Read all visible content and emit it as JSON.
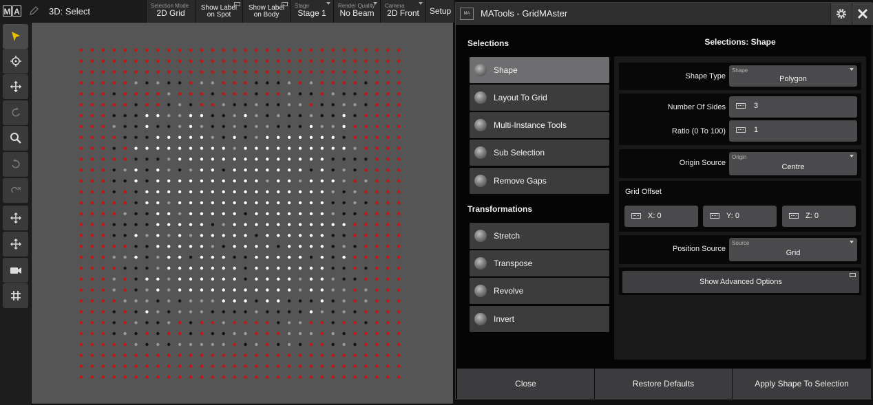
{
  "topbar": {
    "logo": [
      "M",
      "A"
    ],
    "view_title": "3D: Select",
    "buttons": [
      {
        "caption": "Selection Mode",
        "value": "2D Grid"
      },
      {
        "caption": "",
        "value": "Show Label on Spot",
        "line1": "Show Label",
        "line2": "on Spot"
      },
      {
        "caption": "",
        "value": "Show Label on Body",
        "line1": "Show Label",
        "line2": "on Body"
      },
      {
        "caption": "Stage",
        "value": "Stage 1"
      },
      {
        "caption": "Render Quality",
        "value": "No Beam"
      },
      {
        "caption": "Camera",
        "value": "2D Front"
      },
      {
        "caption": "",
        "value": "Setup"
      }
    ]
  },
  "toolbar": {
    "tools": [
      "select-arrow-icon",
      "crosshair-icon",
      "move-icon",
      "rotate-icon",
      "zoom-icon",
      "undo-rotate-icon",
      "pan-rotate-icon",
      "move-alt-icon",
      "move-alt2-icon",
      "camera-icon",
      "grid-icon"
    ]
  },
  "viewport": {
    "colors": {
      "background": "#555555",
      "red": "#cc1111",
      "white": "#ffffff",
      "grey": "#9a9a9a",
      "black": "#111111"
    }
  },
  "plugin": {
    "title": "MATools - GridMAster",
    "icon_text": "MA",
    "selections_heading": "Selections",
    "selections": [
      {
        "label": "Shape",
        "active": true
      },
      {
        "label": "Layout To Grid",
        "active": false
      },
      {
        "label": "Multi-Instance Tools",
        "active": false
      },
      {
        "label": "Sub Selection",
        "active": false
      },
      {
        "label": "Remove Gaps",
        "active": false
      }
    ],
    "transformations_heading": "Transformations",
    "transformations": [
      {
        "label": "Stretch"
      },
      {
        "label": "Transpose"
      },
      {
        "label": "Revolve"
      },
      {
        "label": "Invert"
      }
    ],
    "panel_title": "Selections: Shape",
    "shape_type": {
      "label": "Shape Type",
      "caption": "Shape",
      "value": "Polygon"
    },
    "number_of_sides": {
      "label": "Number Of Sides",
      "value": "3"
    },
    "ratio": {
      "label": "Ratio (0 To 100)",
      "value": "1"
    },
    "origin_source": {
      "label": "Origin Source",
      "caption": "Origin",
      "value": "Centre"
    },
    "grid_offset": {
      "label": "Grid Offset",
      "x": "X: 0",
      "y": "Y: 0",
      "z": "Z: 0"
    },
    "position_source": {
      "label": "Position Source",
      "caption": "Source",
      "value": "Grid"
    },
    "advanced_button": "Show Advanced Options",
    "footer": {
      "close": "Close",
      "restore": "Restore Defaults",
      "apply": "Apply Shape To Selection"
    }
  }
}
